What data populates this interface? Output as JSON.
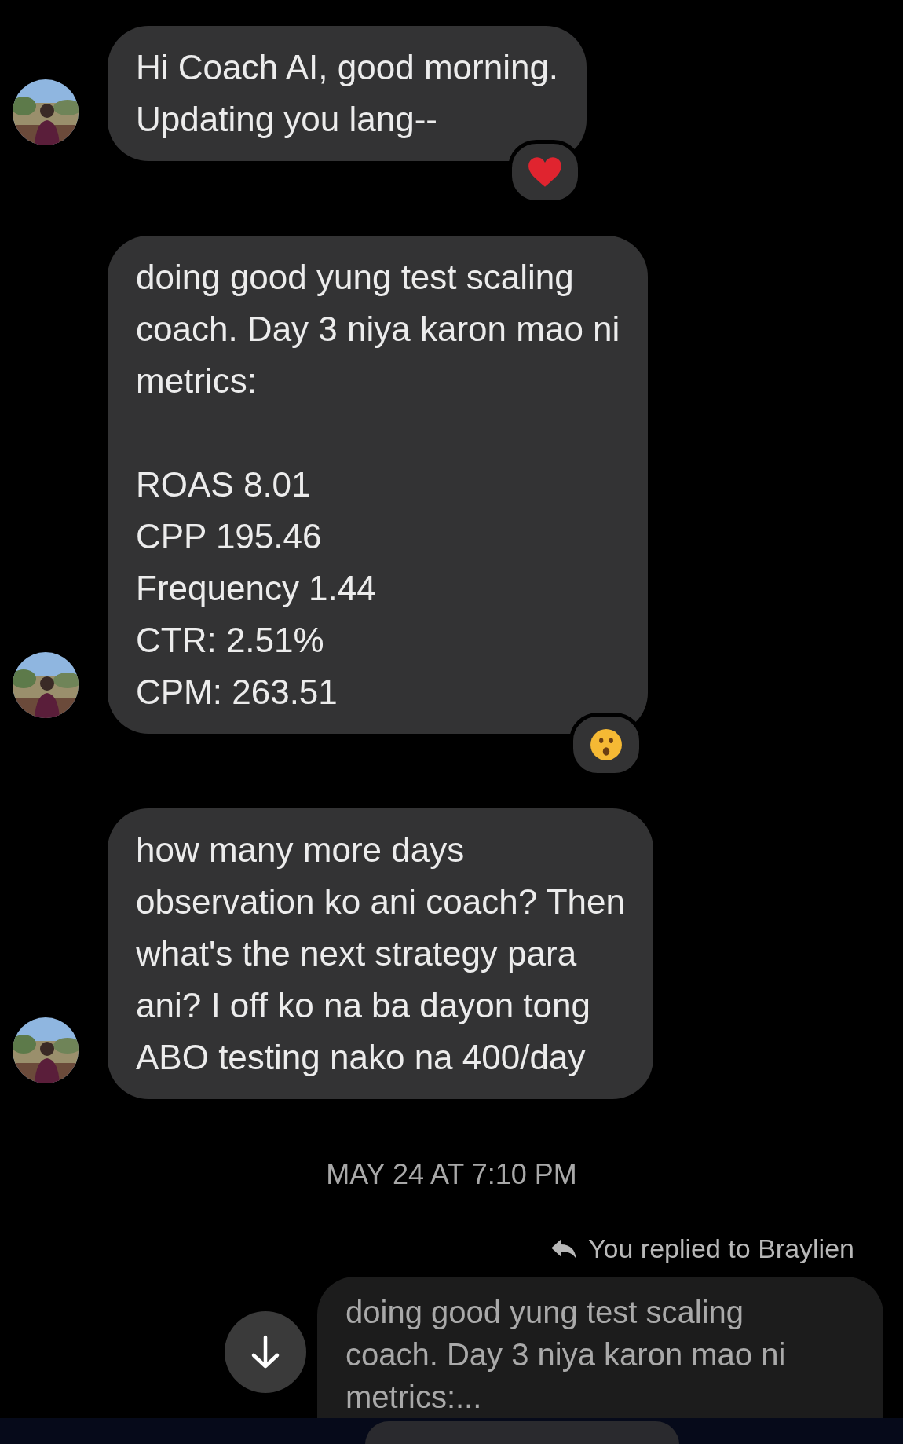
{
  "messages": [
    {
      "kind": "incoming",
      "text": "Hi Coach AI, good morning.\nUpdating you lang--",
      "reaction": {
        "kind": "heart"
      }
    },
    {
      "kind": "incoming",
      "text": "doing good yung test scaling\ncoach. Day 3 niya karon mao ni\nmetrics:\n\nROAS 8.01\nCPP 195.46\nFrequency 1.44\nCTR: 2.51%\nCPM: 263.51",
      "reaction": {
        "kind": "surprised"
      }
    },
    {
      "kind": "incoming",
      "text": "how many more days\nobservation ko ani coach? Then\nwhat's the next strategy para\nani? I off ko na ba dayon tong\nABO testing nako na 400/day"
    }
  ],
  "timestamp": "MAY 24 AT 7:10 PM",
  "reply": {
    "label": "You replied to Braylien",
    "text": "doing good yung test scaling\ncoach. Day 3 niya karon mao ni\nmetrics:..."
  }
}
